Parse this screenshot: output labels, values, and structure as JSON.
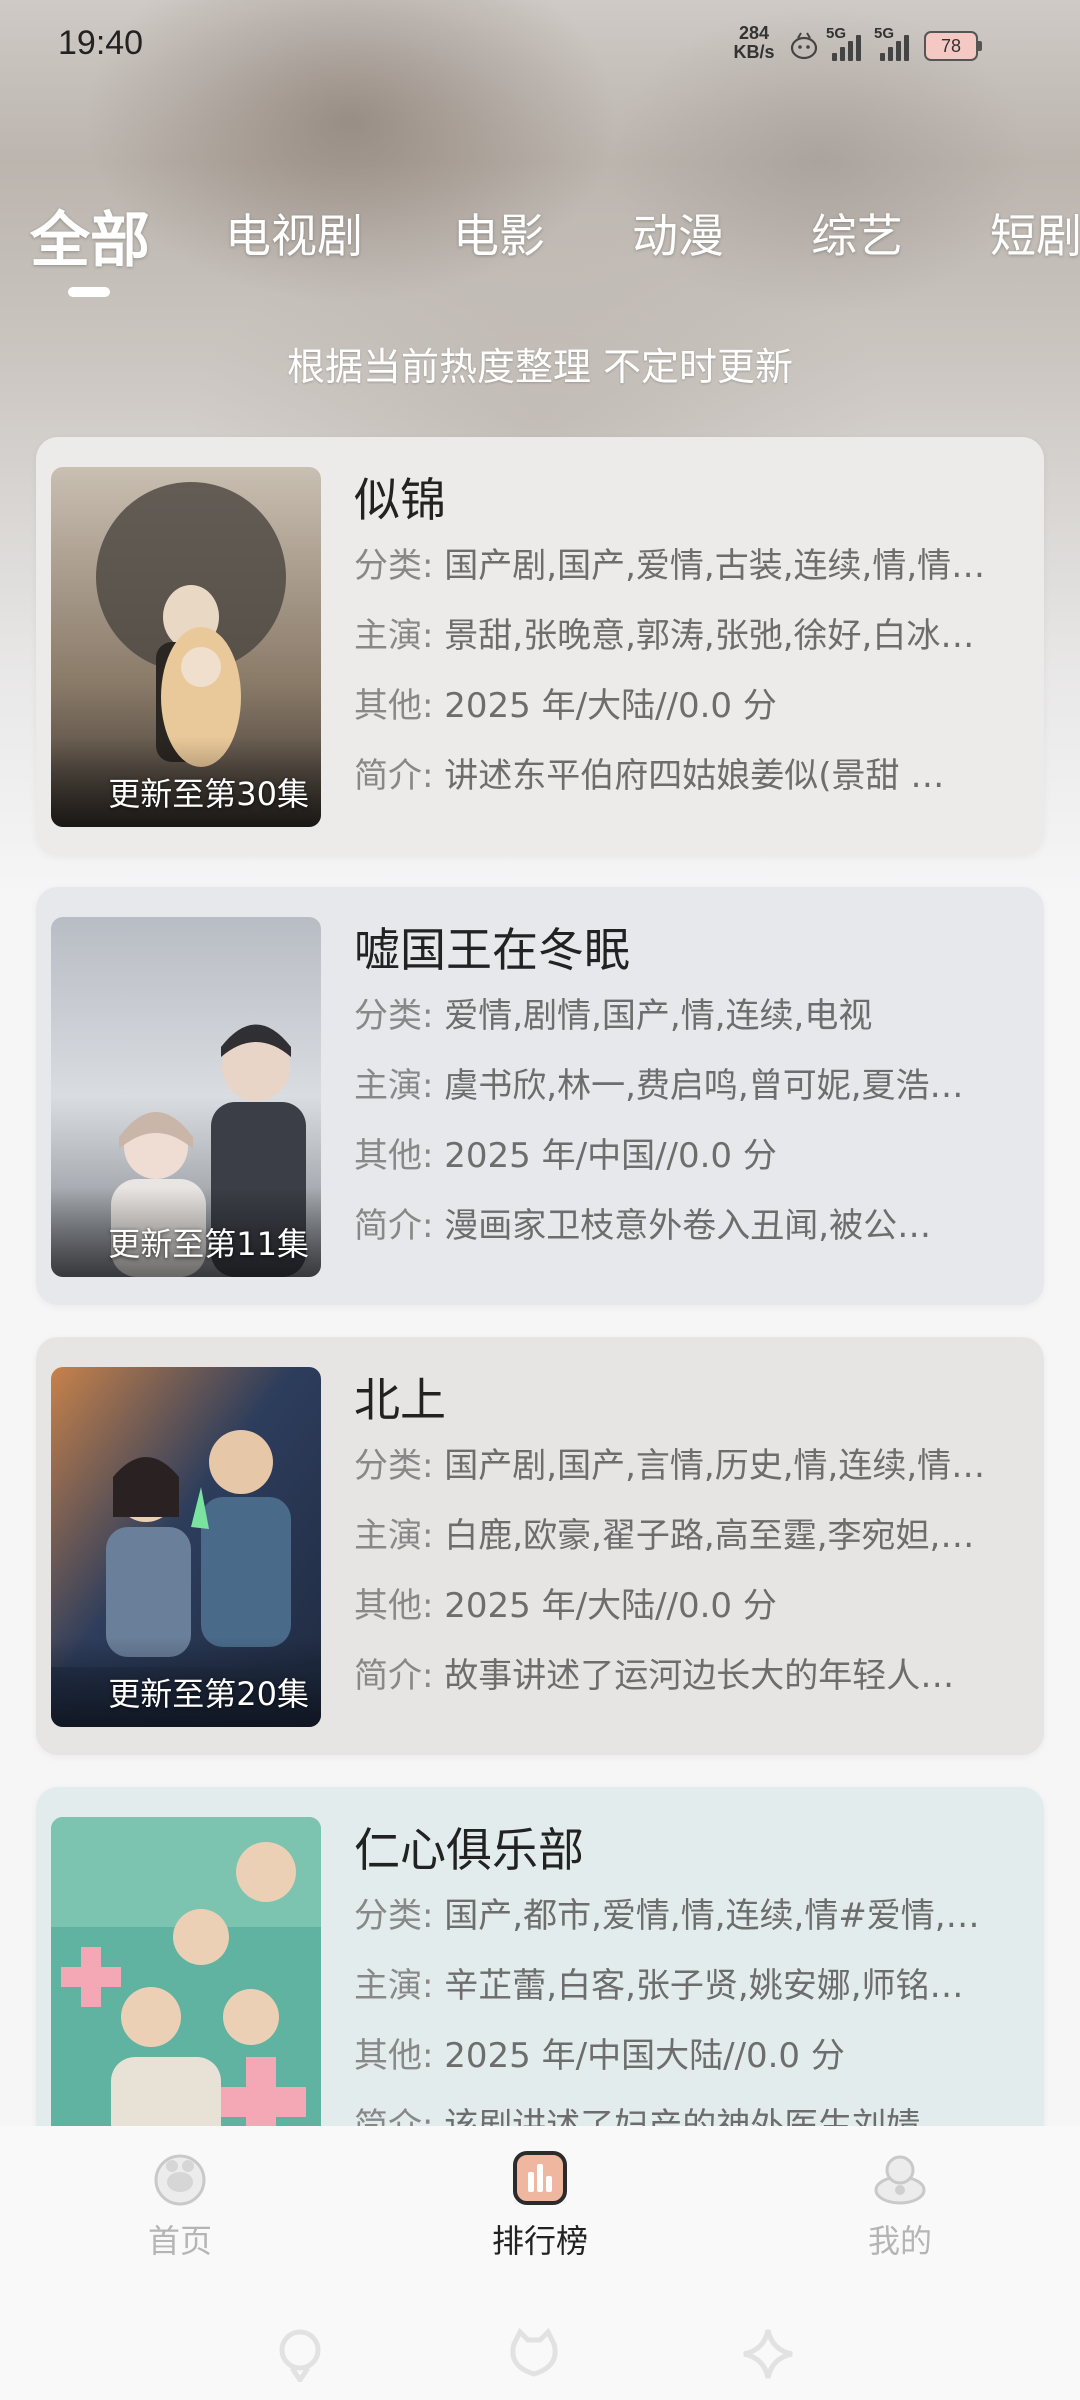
{
  "status": {
    "time": "19:40",
    "speed_value": "284",
    "speed_unit": "KB/s",
    "sim1": "5G",
    "sim2": "5G",
    "battery": "78"
  },
  "tabs": [
    "全部",
    "电视剧",
    "电影",
    "动漫",
    "综艺",
    "短剧"
  ],
  "subtitle": "根据当前热度整理 不定时更新",
  "labels": {
    "category": "分类:",
    "cast": "主演:",
    "other": "其他:",
    "intro": "简介:"
  },
  "items": [
    {
      "title": "似锦",
      "update": "更新至第30集",
      "category": "国产剧,国产,爱情,古装,连续,情,情…",
      "cast": "景甜,张晚意,郭涛,张弛,徐好,白冰…",
      "other": "2025 年/大陆//0.0 分",
      "intro": "讲述东平伯府四姑娘姜似(景甜 …",
      "poster_colors": [
        "#5a5048",
        "#b89a78",
        "#3a342f"
      ],
      "card_bg": "#ecebea"
    },
    {
      "title": "嘘国王在冬眠",
      "update": "更新至第11集",
      "category": "爱情,剧情,国产,情,连续,电视",
      "cast": "虞书欣,林一,费启鸣,曾可妮,夏浩…",
      "other": "2025 年/中国//0.0 分",
      "intro": "漫画家卫枝意外卷入丑闻,被公…",
      "poster_colors": [
        "#9aa0a8",
        "#d7dade",
        "#4a4e55"
      ],
      "card_bg": "#e6e8ec"
    },
    {
      "title": "北上",
      "update": "更新至第20集",
      "category": "国产剧,国产,言情,历史,情,连续,情…",
      "cast": "白鹿,欧豪,翟子路,高至霆,李宛妲,…",
      "other": "2025 年/大陆//0.0 分",
      "intro": "故事讲述了运河边长大的年轻人…",
      "poster_colors": [
        "#2d3d5c",
        "#c8824a",
        "#1f2a40"
      ],
      "card_bg": "#e7e4e4"
    },
    {
      "title": "仁心俱乐部",
      "update": "",
      "category": "国产,都市,爱情,情,连续,情#爱情,…",
      "cast": "辛芷蕾,白客,张子贤,姚安娜,师铭…",
      "other": "2025 年/中国大陆//0.0 分",
      "intro": "该剧讲述了妇产的神外医生刘婧…",
      "poster_colors": [
        "#5fb3a0",
        "#f4a7b4",
        "#2e7d6b"
      ],
      "card_bg": "#e3ecec"
    }
  ],
  "nav": [
    {
      "label": "首页",
      "icon": "home-icon"
    },
    {
      "label": "排行榜",
      "icon": "ranking-icon"
    },
    {
      "label": "我的",
      "icon": "profile-icon"
    }
  ]
}
